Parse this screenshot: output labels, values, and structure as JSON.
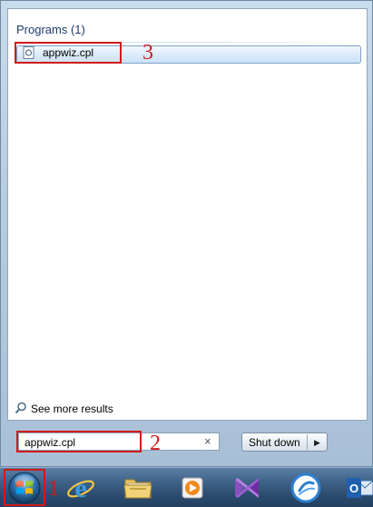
{
  "start_menu": {
    "programs_header": "Programs (1)",
    "program_result": {
      "label": "appwiz.cpl",
      "icon": "control-panel-file-icon"
    },
    "see_more": "See more results",
    "search": {
      "value": "appwiz.cpl",
      "clear_icon": "×"
    },
    "shutdown": {
      "label": "Shut down",
      "arrow": "▶"
    }
  },
  "annotations": {
    "step_1": "1",
    "step_2": "2",
    "step_3": "3",
    "color": "#d01a1a"
  },
  "taskbar": {
    "items": [
      {
        "name": "start-orb",
        "icon": "windows-logo-icon"
      },
      {
        "name": "internet-explorer",
        "icon": "ie-icon"
      },
      {
        "name": "windows-explorer",
        "icon": "folder-icon"
      },
      {
        "name": "media-player",
        "icon": "media-player-icon"
      },
      {
        "name": "visual-studio",
        "icon": "visual-studio-icon"
      },
      {
        "name": "ring-app",
        "icon": "ring-icon"
      },
      {
        "name": "outlook",
        "icon": "outlook-icon"
      }
    ]
  }
}
